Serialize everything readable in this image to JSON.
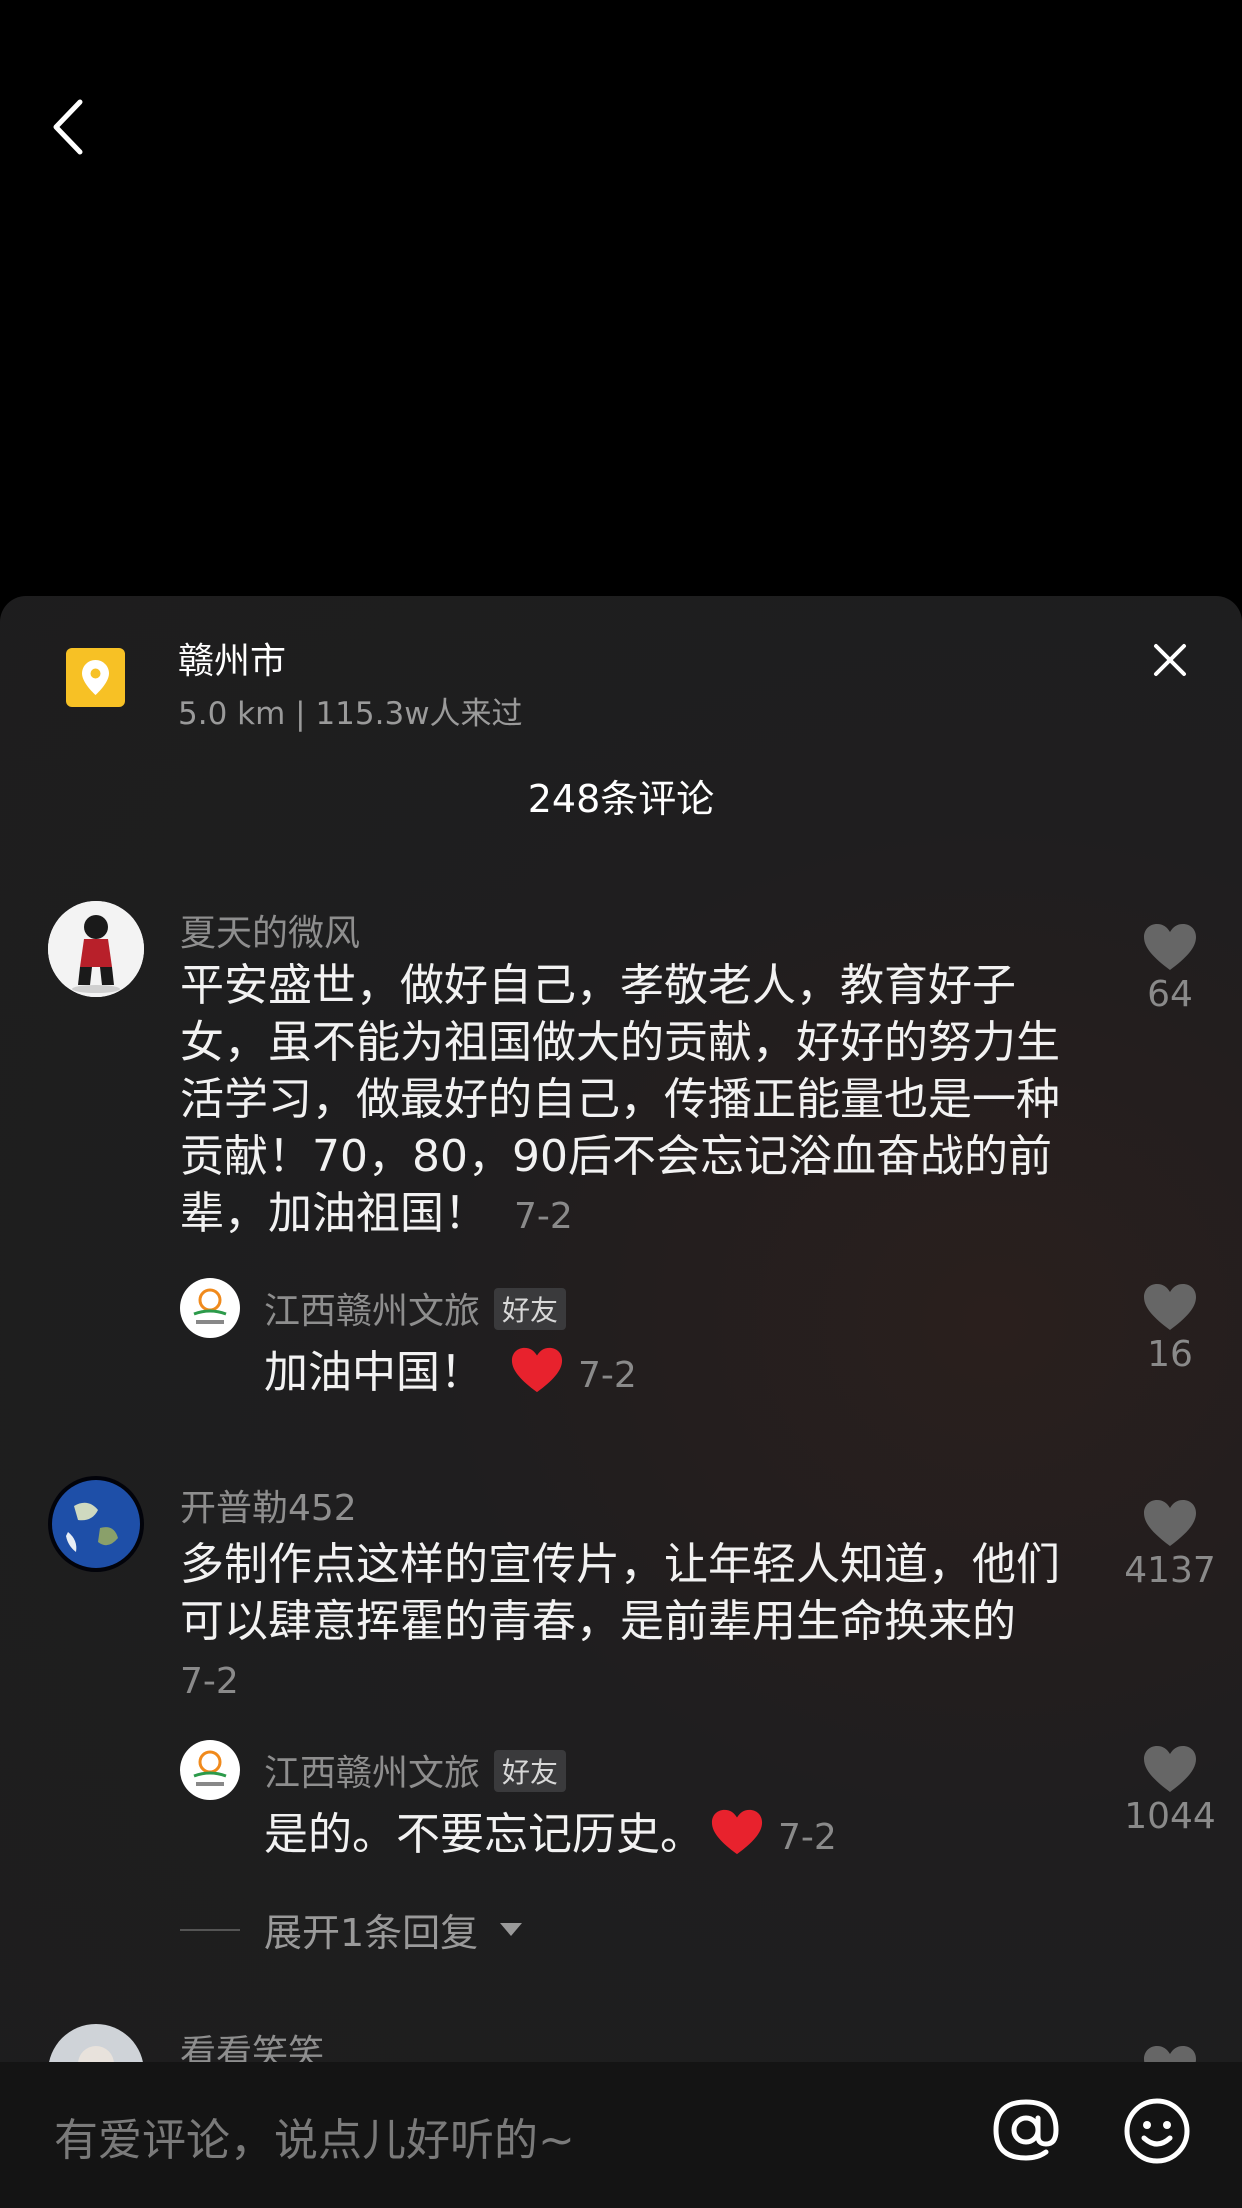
{
  "location": {
    "title": "赣州市",
    "subtitle": "5.0 km  |  115.3w人来过"
  },
  "comments_header": "248条评论",
  "comments": [
    {
      "user": "夏天的微风",
      "text": "平安盛世，做好自己，孝敬老人，教育好子女，虽不能为祖国做大的贡献，好好的努力生活学习，做最好的自己，传播正能量也是一种贡献！70，80，90后不会忘记浴血奋战的前辈，加油祖国！",
      "date": "7-2",
      "likes": "64",
      "reply": {
        "user": "江西赣州文旅",
        "badge": "好友",
        "text": "加油中国！",
        "date": "7-2",
        "likes": "16"
      }
    },
    {
      "user": "开普勒452",
      "text": "多制作点这样的宣传片，让年轻人知道，他们可以肆意挥霍的青春，是前辈用生命换来的",
      "date": "7-2",
      "likes": "4137",
      "reply": {
        "user": "江西赣州文旅",
        "badge": "好友",
        "text": "是的。不要忘记历史。",
        "date": "7-2",
        "likes": "1044"
      },
      "expand_label": "展开1条回复"
    },
    {
      "user": "看看笑笑"
    }
  ],
  "input": {
    "placeholder": "有爱评论，说点儿好听的~"
  },
  "icons": {
    "back": "back-arrow-icon",
    "location": "location-pin-icon",
    "close": "close-icon",
    "like": "heart-icon",
    "at": "at-icon",
    "emoji": "smiley-icon"
  },
  "colors": {
    "location_icon_bg": "#f7c125",
    "heart_red": "#e8222d"
  }
}
